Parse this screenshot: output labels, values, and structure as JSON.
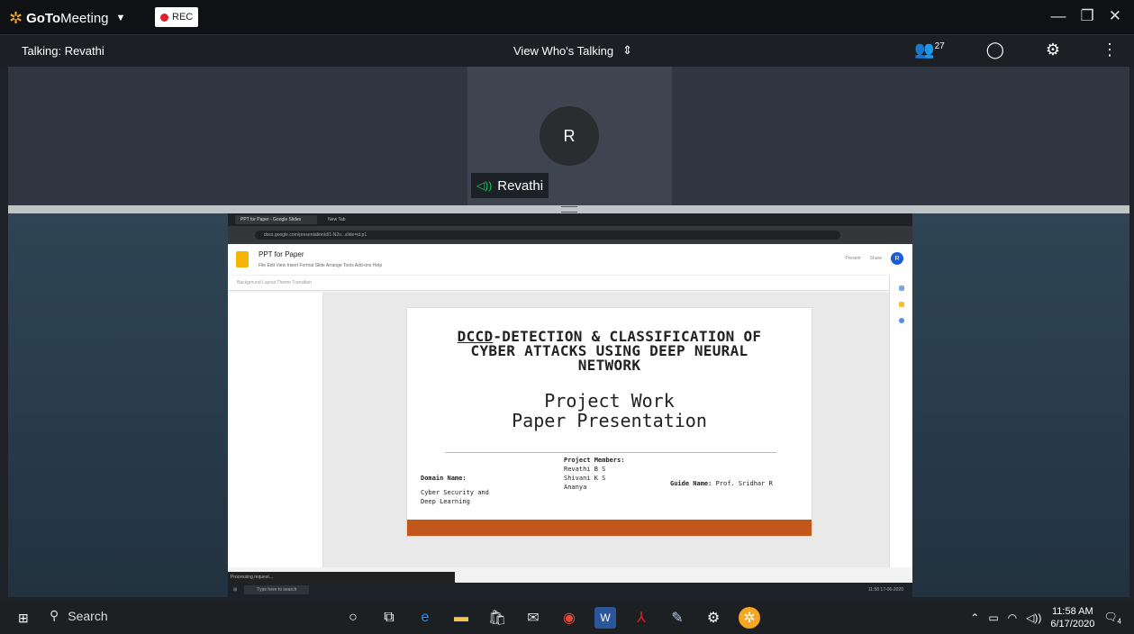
{
  "app": {
    "brand_bold": "GoTo",
    "brand_rest": "Meeting",
    "rec_label": "REC"
  },
  "subbar": {
    "talking": "Talking: Revathi",
    "view_label": "View Who's Talking",
    "attendee_count": "27"
  },
  "tile": {
    "initial": "R",
    "name": "Revathi"
  },
  "browser": {
    "tab1": "PPT for Paper - Google Slides",
    "tab2": "New Tab",
    "url": "docs.google.com/presentation/d/1-N2o...slide=id.p1"
  },
  "slides_app": {
    "doc_title": "PPT for Paper",
    "menu": "File  Edit  View  Insert  Format  Slide  Arrange  Tools  Add-ons  Help",
    "present": "Present",
    "share": "Share",
    "toolbar": "Background   Layout   Theme   Transition",
    "avatar": "R"
  },
  "slide": {
    "title_underlined": "DCCD",
    "title_rest_line1": "-DETECTION & CLASSIFICATION OF",
    "title_line2": "CYBER ATTACKS USING DEEP NEURAL",
    "title_line3": "NETWORK",
    "subtitle_line1": "Project Work",
    "subtitle_line2": "Paper Presentation",
    "members_label": "Project Members:",
    "members": [
      "Revathi B S",
      "Shivani K S",
      "Ananya"
    ],
    "domain_label": "Domain Name:",
    "domain_value_1": "Cyber Security and",
    "domain_value_2": "Deep Learning",
    "guide_label": "Guide Name:",
    "guide_value": "Prof. Sridhar R"
  },
  "inner_taskbar": {
    "search": "Type here to search",
    "processing": "Processing request...",
    "time": "11:58",
    "date": "17-06-2020"
  },
  "taskbar": {
    "search_label": "Search",
    "time": "11:58 AM",
    "date": "6/17/2020",
    "notif_count": "4"
  }
}
